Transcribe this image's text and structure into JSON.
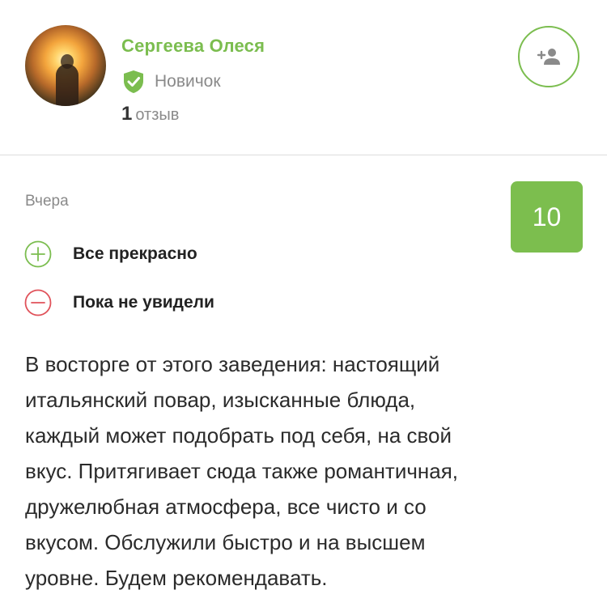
{
  "user": {
    "name": "Сергеева Олеся",
    "status": "Новичок",
    "review_count": "1",
    "review_count_label": "отзыв"
  },
  "review": {
    "date": "Вчера",
    "score": "10",
    "pros": "Все прекрасно",
    "cons": "Пока не увидели",
    "text": "В восторге от этого заведения: настоящий\nитальянский повар, изысканные блюда,\nкаждый может подобрать под себя, на свой\nвкус. Притягивает сюда также романтичная,\nдружелюбная атмосфера, все чисто и со\nвкусом. Обслужили быстро и на высшем\nуровне. Будем рекомендавать."
  },
  "icons": {
    "badge": "verified-shield-icon",
    "follow": "add-user-icon",
    "pros": "plus-circle-icon",
    "cons": "minus-circle-icon"
  },
  "colors": {
    "accent": "#7bbd4f",
    "score_bg": "#7cbe4e",
    "cons": "#e0525a",
    "muted": "#8a8a8a"
  }
}
